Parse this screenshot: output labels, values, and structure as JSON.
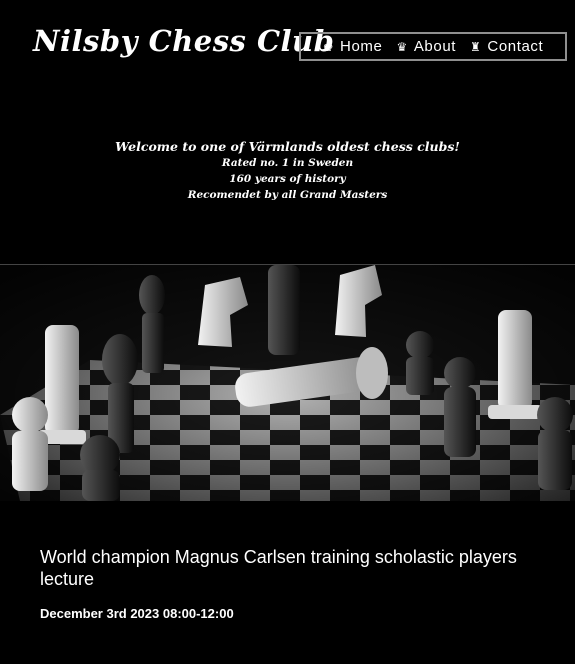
{
  "header": {
    "logo": "Nilsby Chess Club",
    "nav": [
      {
        "icon": "chess-king-icon",
        "glyph": "♚",
        "label": "Home"
      },
      {
        "icon": "chess-queen-icon",
        "glyph": "♛",
        "label": "About"
      },
      {
        "icon": "chess-rook-icon",
        "glyph": "♜",
        "label": "Contact"
      }
    ]
  },
  "welcome": {
    "headline": "Welcome to one of Värmlands oldest chess clubs!",
    "lines": [
      "Rated no. 1 in Sweden",
      "160 years of history",
      "Recomendet by all Grand Masters"
    ]
  },
  "hero": {
    "image_description_icon": "chessboard-photo"
  },
  "event": {
    "title": "World champion Magnus Carlsen training scholastic players lecture",
    "date": "December 3rd 2023 08:00-12:00"
  }
}
